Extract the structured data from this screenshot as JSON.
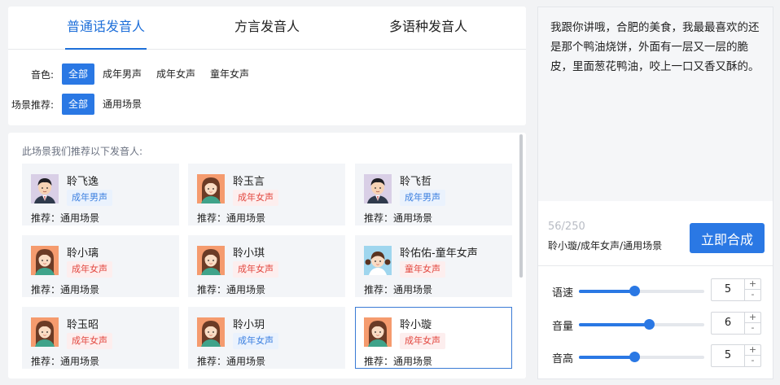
{
  "tabs": [
    "普通话发音人",
    "方言发音人",
    "多语种发音人"
  ],
  "filters": {
    "timbre_label": "音色:",
    "timbre_options": [
      "全部",
      "成年男声",
      "成年女声",
      "童年女声"
    ],
    "scene_label": "场景推荐:",
    "scene_options": [
      "全部",
      "通用场景"
    ]
  },
  "list_hint": "此场景我们推荐以下发音人:",
  "speakers": [
    {
      "name": "聆飞逸",
      "tag": "成年男声",
      "tag_type": "male",
      "rec": "推荐：通用场景",
      "avatar": "male-avatar"
    },
    {
      "name": "聆玉言",
      "tag": "成年女声",
      "tag_type": "female",
      "rec": "推荐：通用场景",
      "avatar": "female-avatar"
    },
    {
      "name": "聆飞哲",
      "tag": "成年男声",
      "tag_type": "male",
      "rec": "推荐：通用场景",
      "avatar": "male-avatar"
    },
    {
      "name": "聆小璃",
      "tag": "成年女声",
      "tag_type": "female",
      "rec": "推荐：通用场景",
      "avatar": "female-avatar"
    },
    {
      "name": "聆小琪",
      "tag": "成年女声",
      "tag_type": "female",
      "rec": "推荐：通用场景",
      "avatar": "female-avatar"
    },
    {
      "name": "聆佑佑-童年女声",
      "tag": "童年女声",
      "tag_type": "female",
      "rec": "推荐：通用场景",
      "avatar": "girl-avatar"
    },
    {
      "name": "聆玉昭",
      "tag": "成年女声",
      "tag_type": "female",
      "rec": "推荐：通用场景",
      "avatar": "female-avatar"
    },
    {
      "name": "聆小玥",
      "tag": "成年女声",
      "tag_type": "male",
      "rec": "推荐：通用场景",
      "avatar": "female-avatar"
    },
    {
      "name": "聆小璇",
      "tag": "成年女声",
      "tag_type": "female",
      "rec": "推荐：通用场景",
      "avatar": "female-avatar",
      "selected": true
    }
  ],
  "editor": {
    "text": "我跟你讲哦，合肥的美食，我最最喜欢的还是那个鸭油烧饼，外面有一层又一层的脆皮，里面葱花鸭油，咬上一口又香又酥的。",
    "char_count": "56/250",
    "current_voice": "聆小璇/成年女声/通用场景",
    "synth_label": "立即合成"
  },
  "sliders": [
    {
      "label": "语速",
      "value": "5",
      "level": 0.44
    },
    {
      "label": "音量",
      "value": "6",
      "level": 0.56
    },
    {
      "label": "音高",
      "value": "5",
      "level": 0.44
    }
  ],
  "stepper_up": "+",
  "stepper_down": "-",
  "colors": {
    "accent": "#2a78e4",
    "male_tag": "#3a7fe0",
    "female_tag": "#e2473f"
  }
}
